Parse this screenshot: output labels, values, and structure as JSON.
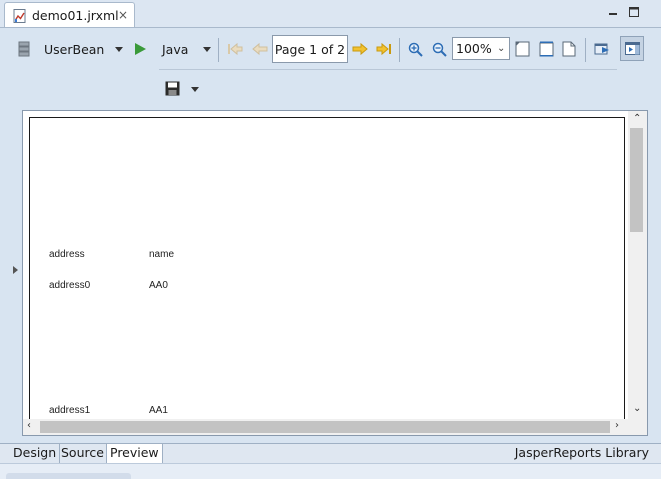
{
  "editor_tab": {
    "title": "demo01.jrxml",
    "close_icon": "×"
  },
  "toolbar": {
    "datasource": "UserBean",
    "language": "Java",
    "page_indicator": "Page 1 of 2",
    "zoom": "100%"
  },
  "report": {
    "rows": [
      {
        "address": "address",
        "name": "name"
      },
      {
        "address": "address0",
        "name": "AA0"
      },
      {
        "address": "address1",
        "name": "AA1"
      }
    ]
  },
  "bottom_tabs": {
    "design": "Design",
    "source": "Source",
    "preview": "Preview",
    "library": "JasperReports Library"
  },
  "colors": {
    "accent_green": "#3a9a3a",
    "nav_orange": "#e0a020",
    "frame_blue": "#d8e4f1"
  }
}
